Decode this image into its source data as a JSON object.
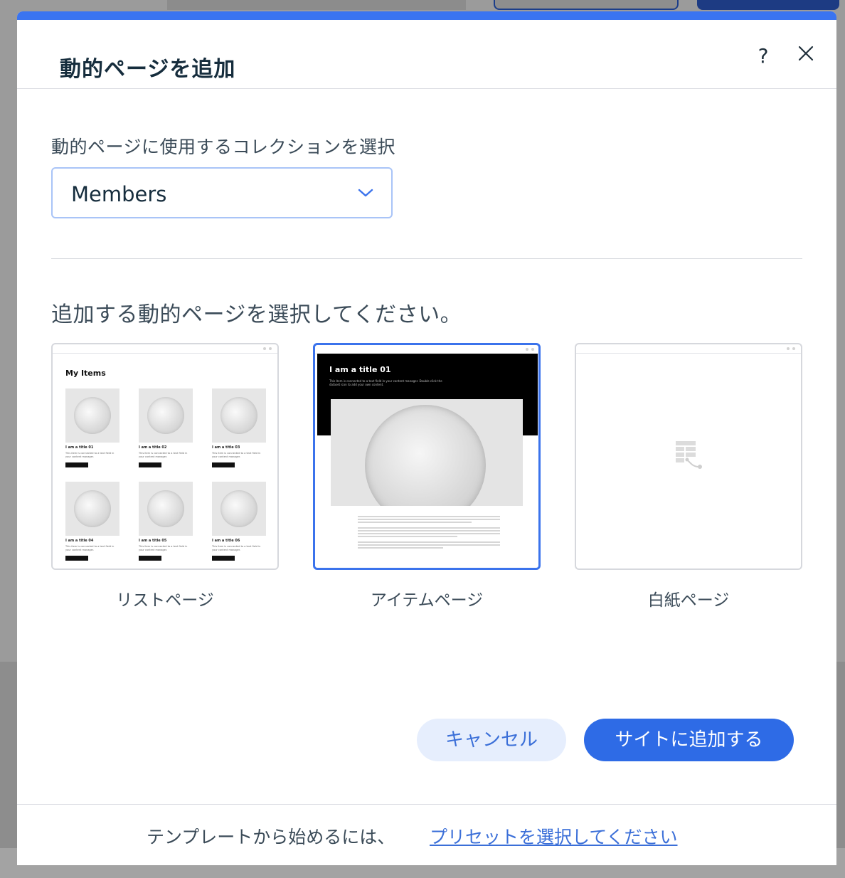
{
  "dialog": {
    "title": "動的ページを追加",
    "help_glyph": "?",
    "close_glyph": "close"
  },
  "collection": {
    "label": "動的ページに使用するコレクションを選択",
    "selected": "Members"
  },
  "pages": {
    "prompt": "追加する動的ページを選択してください。",
    "options": [
      {
        "label": "リストページ",
        "thumbnail": {
          "heading": "My Items",
          "items": [
            {
              "title": "I am a title 01",
              "desc": "This item is connected to a text field in your content manager.",
              "button": "Read More"
            },
            {
              "title": "I am a title 02",
              "desc": "This item is connected to a text field in your content manager.",
              "button": "Read More"
            },
            {
              "title": "I am a title 03",
              "desc": "This item is connected to a text field in your content manager.",
              "button": "Read More"
            },
            {
              "title": "I am a title 04",
              "desc": "This item is connected to a text field in your content manager.",
              "button": "Read More"
            },
            {
              "title": "I am a title 05",
              "desc": "This item is connected to a text field in your content manager.",
              "button": "Read More"
            },
            {
              "title": "I am a title 06",
              "desc": "This item is connected to a text field in your content manager.",
              "button": "Read More"
            }
          ]
        }
      },
      {
        "label": "アイテムページ",
        "selected": true,
        "thumbnail": {
          "heading": "I am a title 01",
          "sub": "This item is connected to a text field in your content manager. Double click the dataset icon to add your own content."
        }
      },
      {
        "label": "白紙ページ",
        "icon": "blank-page-icon"
      }
    ]
  },
  "actions": {
    "cancel": "キャンセル",
    "add": "サイトに追加する"
  },
  "footer": {
    "text": "テンプレートから始めるには、",
    "link": "プリセットを選択してください"
  },
  "colors": {
    "accent": "#3a74f0",
    "primary_button": "#2e6be6",
    "secondary_button": "#e6eefd"
  }
}
